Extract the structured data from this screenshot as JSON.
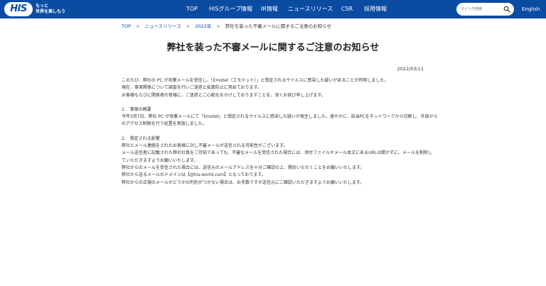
{
  "header": {
    "logo": {
      "mark": "HIS",
      "tagline_1": "もっと",
      "tagline_2": "世界を楽しもう"
    },
    "nav": [
      "TOP",
      "HISグループ情報",
      "IR情報",
      "ニュースリリース",
      "CSR",
      "採用情報"
    ],
    "search": {
      "placeholder": "サイト内検索"
    },
    "language": "English",
    "colors": {
      "bar": "#0b4ca3"
    }
  },
  "breadcrumb": [
    "TOP",
    "ニュースリリース",
    "2022年",
    "弊社を装った不審メールに関するご注意のお知らせ"
  ],
  "article": {
    "title": "弊社を装った不審メールに関するご注意のお知らせ",
    "date": "2022/03/11",
    "intro": [
      "このたび、弊社の PC が攻撃メールを受信し、「Emotet（エモテット）」と想定されるウイルスに感染した疑いがあることが判明しました。",
      "現在、事実関係について調査を行いご迷惑と拡散防止に努めております。",
      "お客様ならびに関係者の皆様に、ご迷惑とご心配をおかけしておりますことを、深くお詫び申し上げます。"
    ],
    "section1": {
      "heading": "1.　事案の概要",
      "lines": [
        "今年3月7日、弊社 PC が攻撃メールにて「Emotet」と想定されるウイルスに感染した疑いが発生しました。速やかに、該当PCをネットワークから切断し、外部から",
        "のアクセス制限を行う処置を実施しました。"
      ]
    },
    "section2": {
      "heading": "2.　想定される影響",
      "lines": [
        "弊社とメール連絡をされたお客様に対し不審メールが送信される可能性がございます。",
        "メール送信者に記載された弊社社員をご存知であっても、不審なメールを受信された場合には、添付ファイルやメール本文にあるURLは開かずに、メールを削除し",
        "ていただきますようお願いいたします。",
        "弊社からのメールを受信された場合には、送信元のメールアドレスを十分ご確認の上、開封いただくことをお願いいたします。",
        "弊社から送るメールのドメインは【@his-world.com】となっております。",
        "弊社からの正規のメールかどうかの判別がつかない場合は、お手数ですが送信元にご確認いただきますようお願いいたします。"
      ]
    }
  }
}
